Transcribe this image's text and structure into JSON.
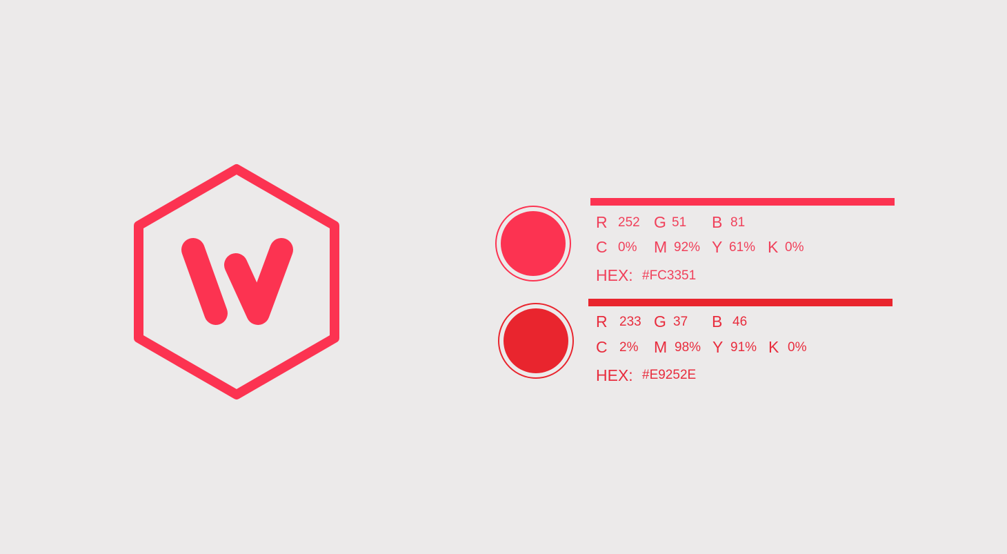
{
  "logo": {
    "letter": "W",
    "icon": "hexagon-w-logo"
  },
  "swatches": [
    {
      "hex_color": "#FC3351",
      "text_color": "#F0405A",
      "r_label": "R",
      "r_value": "252",
      "g_label": "G",
      "g_value": "51",
      "b_label": "B",
      "b_value": "81",
      "c_label": "C",
      "c_value": "0%",
      "m_label": "M",
      "m_value": "92%",
      "y_label": "Y",
      "y_value": "61%",
      "k_label": "K",
      "k_value": "0%",
      "hex_label": "HEX:",
      "hex_value": "#FC3351"
    },
    {
      "hex_color": "#E9252E",
      "text_color": "#E82C3D",
      "r_label": "R",
      "r_value": "233",
      "g_label": "G",
      "g_value": "37",
      "b_label": "B",
      "b_value": "46",
      "c_label": "C",
      "c_value": "2%",
      "m_label": "M",
      "m_value": "98%",
      "y_label": "Y",
      "y_value": "91%",
      "k_label": "K",
      "k_value": "0%",
      "hex_label": "HEX:",
      "hex_value": "#E9252E"
    }
  ]
}
